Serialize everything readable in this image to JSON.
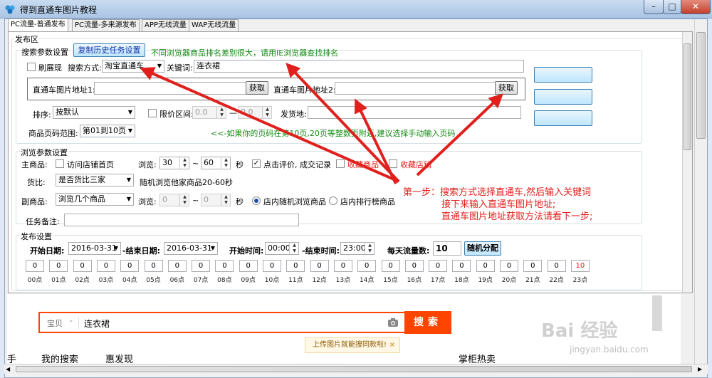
{
  "window": {
    "title": "得到直通车图片教程",
    "min": "–",
    "max": "□",
    "close": "✕"
  },
  "tabs": [
    "PC流量-普通发布",
    "PC流量-多来源发布",
    "APP无线流量",
    "WAP无线流量"
  ],
  "publish": {
    "group_title": "发布区",
    "search_params": {
      "title": "搜索参数设置",
      "copy_history_btn": "复制历史任务设置",
      "browser_note": "不同浏览器商品排名差别很大，请用IE浏览器查找排名",
      "refresh_label": "刷展现",
      "search_mode_label": "搜索方式:",
      "search_mode_value": "淘宝直通车",
      "keyword_label": "关键词:",
      "keyword_value": "连衣裙",
      "img_addr1_label": "直通车图片地址1:",
      "img_addr2_label": "直通车图片地址2:",
      "fetch_btn": "获取",
      "sort_label": "排序:",
      "sort_value": "按默认",
      "price_range_label": "限价区间:",
      "price_min": "0.0",
      "price_max": "0.0",
      "dash": "—",
      "ship_from_label": "发货地:",
      "page_range_label": "商品页码范围:",
      "page_range_value": "第01到10页",
      "page_note": "<<-如果你的页码在第10页,20页等整数页附近,建议选择手动输入页码"
    },
    "side_buttons": [
      "关键词排名查询",
      "发布教程",
      "直通车教程"
    ],
    "browse_params": {
      "title": "浏览参数设置",
      "main_item_label": "主商品:",
      "visit_shop_home": "访问店铺首页",
      "browse_label": "浏览:",
      "browse_min": "30",
      "tilde": "~",
      "browse_max": "60",
      "sec_label": "秒",
      "click_review": "点击评价, 成交记录",
      "fav_item": "收藏商品",
      "fav_shop": "收藏店铺",
      "compare_label": "货比:",
      "compare_value": "是否货比三家",
      "compare_note": "随机浏览他家商品20-60秒",
      "sub_item_label": "副商品:",
      "sub_item_value": "浏览几个商品",
      "sub_browse_min": "0",
      "sub_browse_max": "0",
      "in_shop_random": "店内随机浏览商品",
      "in_shop_rank": "店内排行榜商品"
    },
    "task_note_label": "任务备注:",
    "schedule": {
      "title": "发布设置",
      "start_date_label": "开始日期:",
      "start_date": "2016-03-31",
      "end_date_label": "-结束日期:",
      "end_date": "2016-03-31",
      "start_time_label": "开始时间:",
      "start_time": "00:00",
      "end_time_label": "-结束时间:",
      "end_time": "23:00",
      "daily_label": "每天流量数:",
      "daily_value": "10",
      "random_btn": "随机分配",
      "hours": [
        {
          "v": "0",
          "l": "00点"
        },
        {
          "v": "0",
          "l": "01点"
        },
        {
          "v": "0",
          "l": "02点"
        },
        {
          "v": "0",
          "l": "03点"
        },
        {
          "v": "0",
          "l": "04点"
        },
        {
          "v": "0",
          "l": "05点"
        },
        {
          "v": "0",
          "l": "06点"
        },
        {
          "v": "0",
          "l": "07点"
        },
        {
          "v": "0",
          "l": "08点"
        },
        {
          "v": "0",
          "l": "09点"
        },
        {
          "v": "0",
          "l": "10点"
        },
        {
          "v": "0",
          "l": "11点"
        },
        {
          "v": "0",
          "l": "12点"
        },
        {
          "v": "0",
          "l": "13点"
        },
        {
          "v": "0",
          "l": "14点"
        },
        {
          "v": "0",
          "l": "15点"
        },
        {
          "v": "0",
          "l": "16点"
        },
        {
          "v": "0",
          "l": "17点"
        },
        {
          "v": "0",
          "l": "18点"
        },
        {
          "v": "0",
          "l": "19点"
        },
        {
          "v": "0",
          "l": "20点"
        },
        {
          "v": "0",
          "l": "21点"
        },
        {
          "v": "0",
          "l": "22点"
        },
        {
          "v": "10",
          "l": "23点"
        }
      ]
    }
  },
  "annotation": {
    "lines": [
      "第一步：搜索方式选择直通车,然后输入关键词",
      "接下来输入直通车图片地址;",
      "直通车图片地址获取方法请看下一步;"
    ],
    "color": "#e0201c"
  },
  "web": {
    "category": "宝贝",
    "query": "连衣裙",
    "search_btn": "搜索",
    "tip": "上传图片就能搜同款啦!",
    "tip_close": "×",
    "nav": [
      "手",
      "我的搜索",
      "惠发现",
      "掌柜热卖"
    ],
    "accent": "#ff4400"
  },
  "watermark": {
    "logo": "Bai 经验",
    "url": "jingyan.baidu.com"
  }
}
